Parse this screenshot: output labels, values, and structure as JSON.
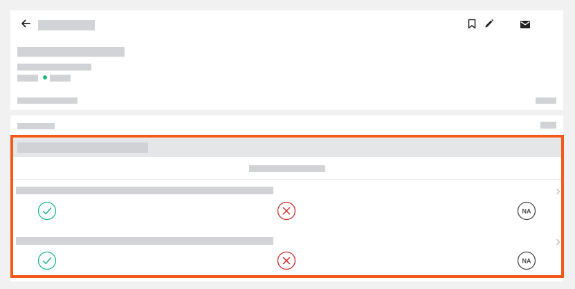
{
  "header": {
    "back_icon": "arrow-left-icon",
    "actions": [
      {
        "icon": "bookmark-icon"
      },
      {
        "icon": "pencil-icon"
      },
      {
        "icon": "mail-icon"
      }
    ]
  },
  "status": {
    "color": "#1eb980"
  },
  "checklist": {
    "items": [
      {
        "options": [
          {
            "icon": "check-circle-icon",
            "color": "#1eb980"
          },
          {
            "icon": "x-circle-icon",
            "color": "#cf2b2b"
          },
          {
            "icon": "na-circle-icon",
            "label": "NA",
            "color": "#4a4a4a"
          }
        ]
      },
      {
        "options": [
          {
            "icon": "check-circle-icon",
            "color": "#1eb980"
          },
          {
            "icon": "x-circle-icon",
            "color": "#cf2b2b"
          },
          {
            "icon": "na-circle-icon",
            "label": "NA",
            "color": "#4a4a4a"
          }
        ]
      }
    ]
  },
  "colors": {
    "highlight": "#f25a1a",
    "placeholder": "#d2d3d6",
    "section_header": "#e4e6e8"
  }
}
